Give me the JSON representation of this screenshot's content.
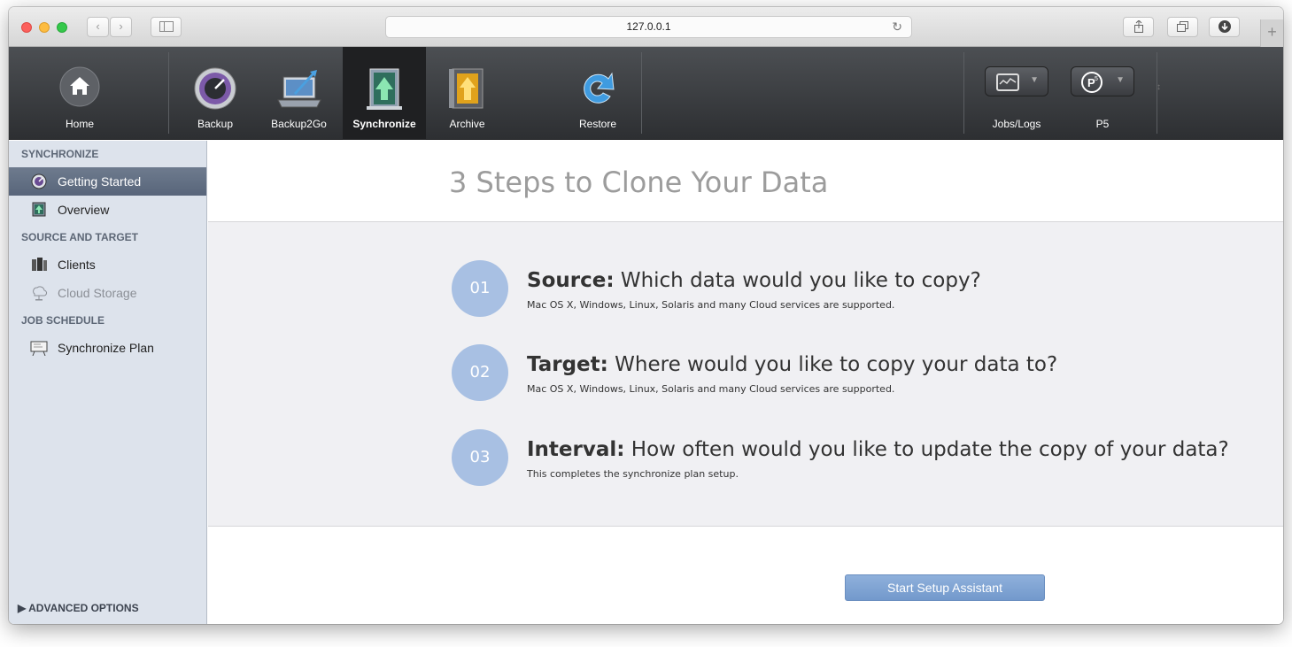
{
  "browser": {
    "url": "127.0.0.1"
  },
  "toolbar": {
    "home": "Home",
    "backup": "Backup",
    "backup2go": "Backup2Go",
    "synchronize": "Synchronize",
    "archive": "Archive",
    "restore": "Restore",
    "jobs_logs": "Jobs/Logs",
    "p5": "P5"
  },
  "sidebar": {
    "section_synchronize": "SYNCHRONIZE",
    "getting_started": "Getting Started",
    "overview": "Overview",
    "section_source_target": "SOURCE AND TARGET",
    "clients": "Clients",
    "cloud_storage": "Cloud Storage",
    "section_job_schedule": "JOB SCHEDULE",
    "synchronize_plan": "Synchronize Plan",
    "advanced_options": "ADVANCED OPTIONS"
  },
  "main": {
    "title": "3 Steps to Clone Your Data",
    "steps": [
      {
        "number": "01",
        "label": "Source:",
        "question": "Which data would you like to copy?",
        "description": "Mac OS X, Windows, Linux, Solaris and many Cloud services are supported."
      },
      {
        "number": "02",
        "label": "Target:",
        "question": "Where would you like to copy your data to?",
        "description": "Mac OS X, Windows, Linux, Solaris and many Cloud services are supported."
      },
      {
        "number": "03",
        "label": "Interval:",
        "question": "How often would you like to update the copy of your data?",
        "description": "This completes the synchronize plan setup."
      }
    ],
    "start_button": "Start Setup Assistant"
  },
  "colors": {
    "accent": "#a8c0e3",
    "button": "#7fa3d3",
    "toolbar": "#3a3c40",
    "sidebar": "#dde3ec"
  }
}
